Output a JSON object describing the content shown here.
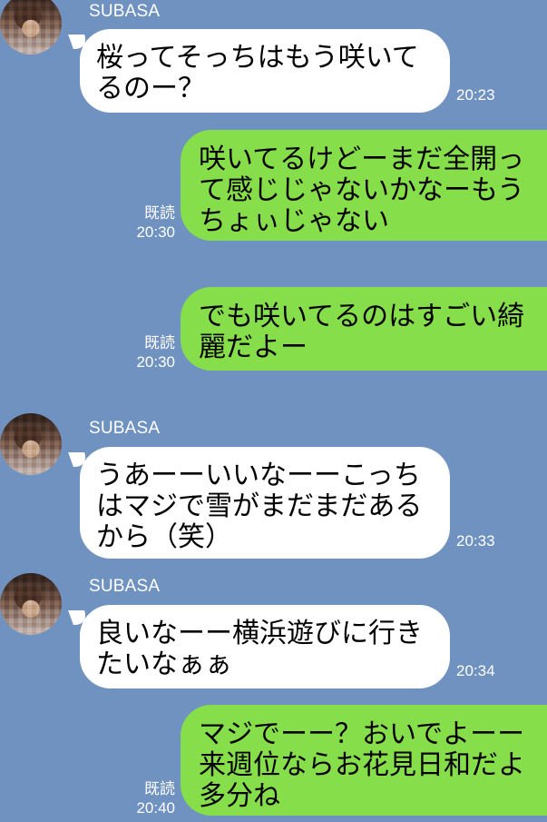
{
  "chat": {
    "messages": [
      {
        "direction": "incoming",
        "sender": "SUBASA",
        "text": "桜ってそっちはもう咲いて\nるのー？",
        "time": "20:23"
      },
      {
        "direction": "outgoing",
        "read_label": "既読",
        "text": "咲いてるけどーまだ全開っ\nて感じじゃないかなーもう\nちょぃじゃない",
        "time": "20:30"
      },
      {
        "direction": "outgoing",
        "read_label": "既読",
        "text": "でも咲いてるのはすごい綺\n麗だよー",
        "time": "20:30"
      },
      {
        "direction": "incoming",
        "sender": "SUBASA",
        "text": "うあーーいいなーーこっち\nはマジで雪がまだまだある\nから（笑）",
        "time": "20:33"
      },
      {
        "direction": "incoming",
        "sender": "SUBASA",
        "text": "良いなーー横浜遊びに行き\nたいなぁぁ",
        "time": "20:34"
      },
      {
        "direction": "outgoing",
        "read_label": "既読",
        "text": "マジでーー？おいでよーー\n来週位ならお花見日和だよ\n多分ね",
        "time": "20:40"
      }
    ]
  },
  "theme": {
    "background": "#7092c0",
    "incoming_bubble": "#ffffff",
    "outgoing_bubble": "#86df4a",
    "meta_text": "#ffffff"
  }
}
